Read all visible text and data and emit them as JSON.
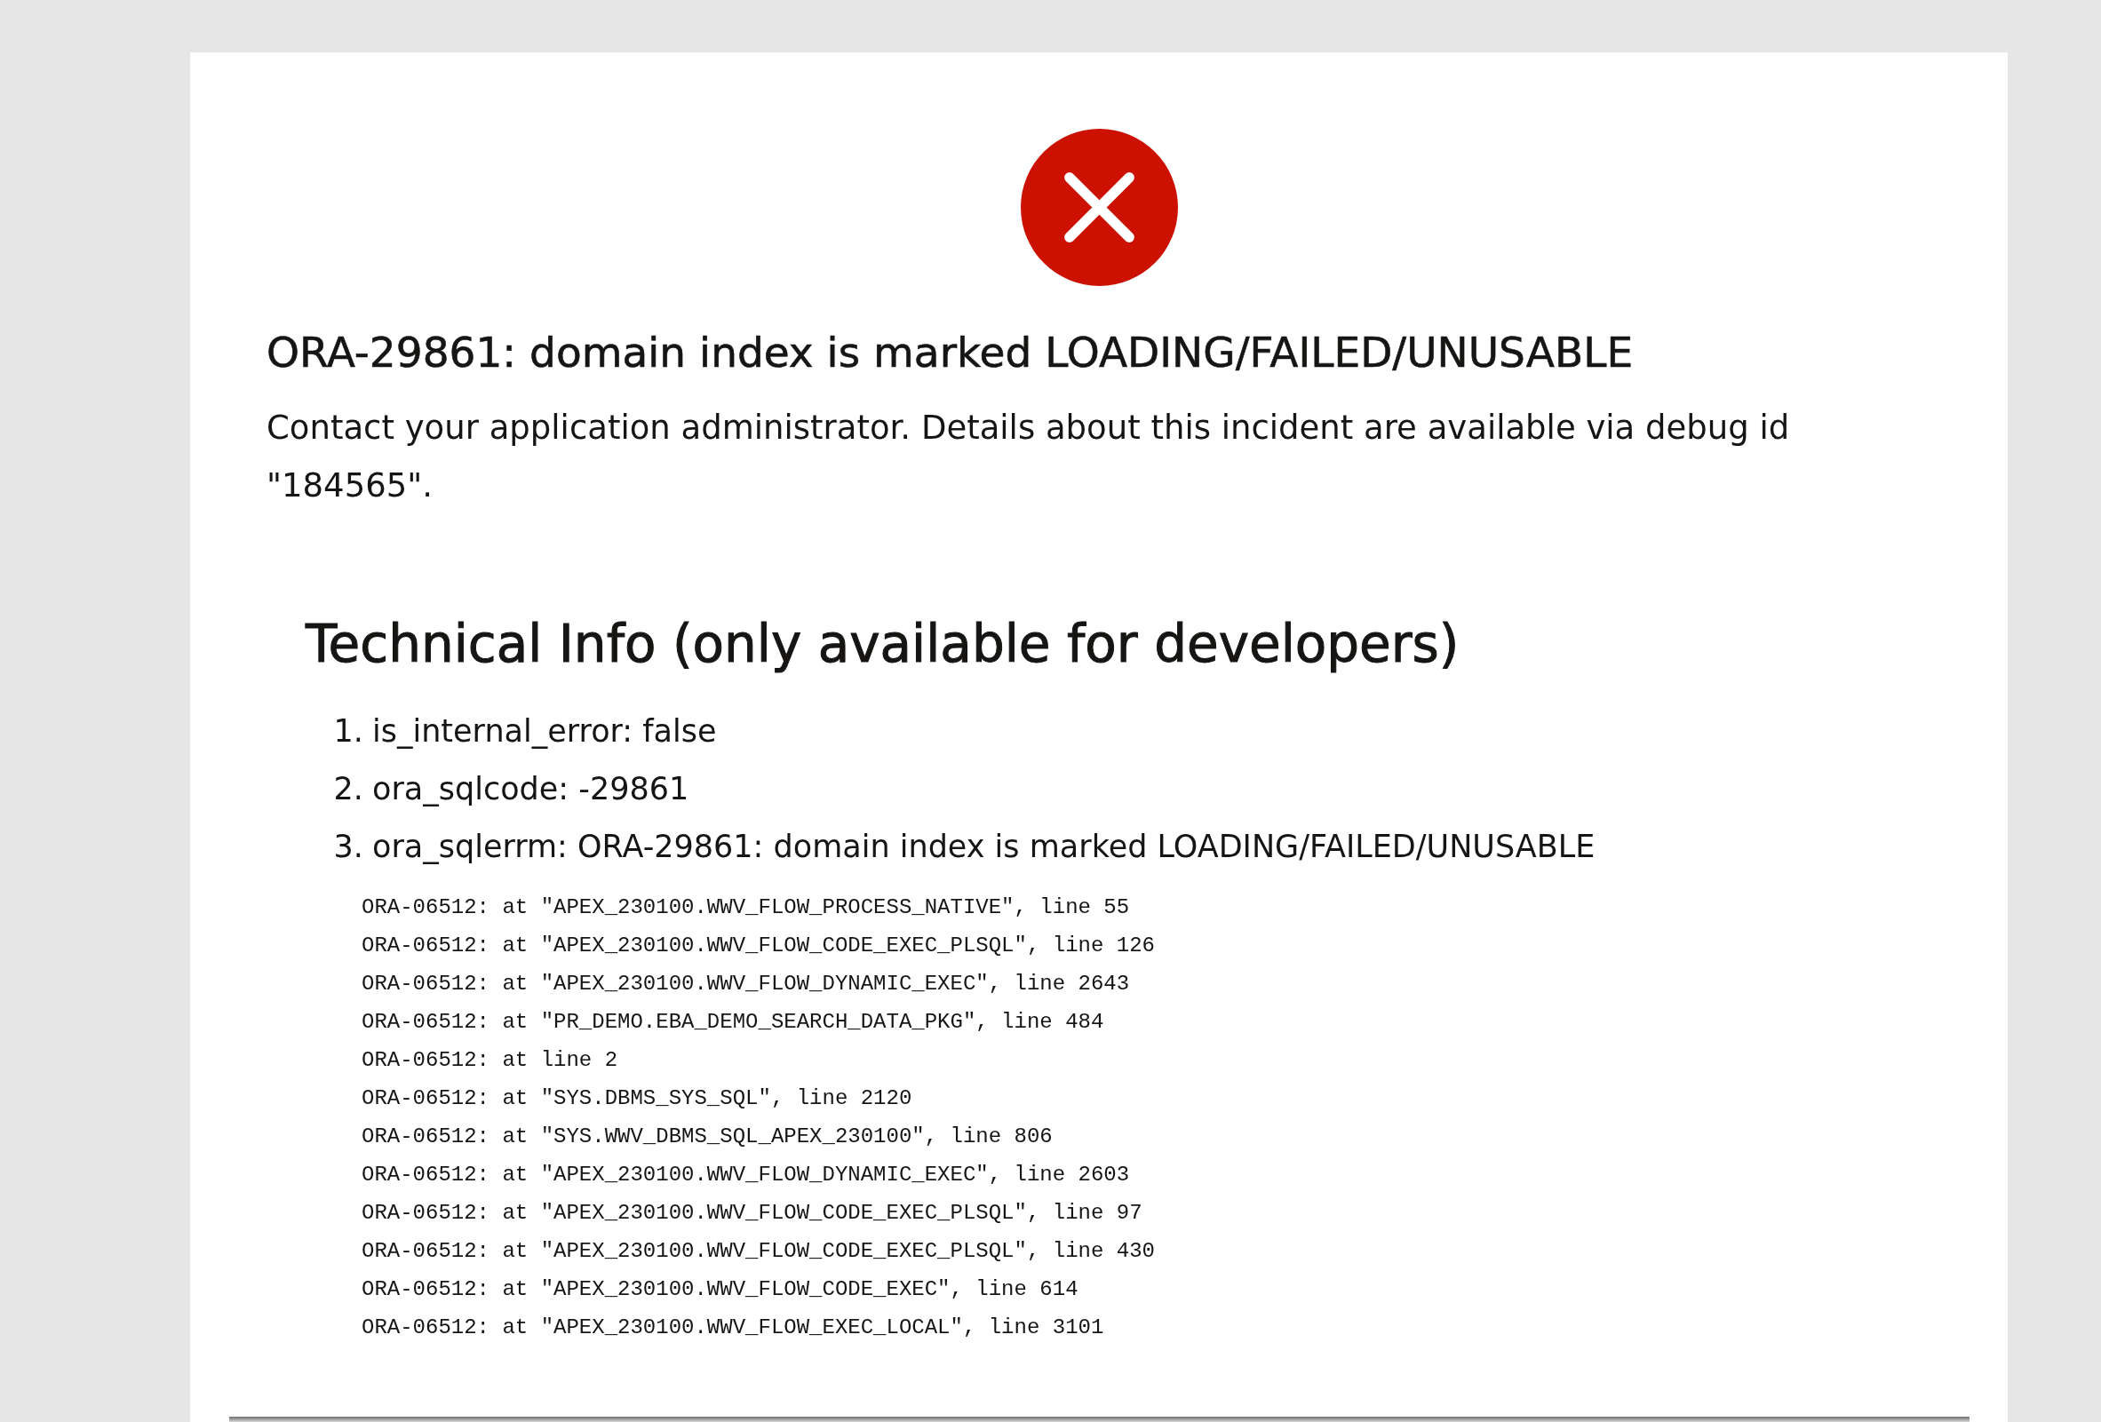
{
  "error": {
    "title": "ORA-29861: domain index is marked LOADING/FAILED/UNUSABLE",
    "message": "Contact your application administrator. Details about this incident are available via debug id \"184565\"."
  },
  "technical_info": {
    "heading": "Technical Info (only available for developers)",
    "items": [
      {
        "number": "1.",
        "text": "is_internal_error: false"
      },
      {
        "number": "2.",
        "text": "ora_sqlcode: -29861"
      },
      {
        "number": "3.",
        "text": "ora_sqlerrm: ORA-29861: domain index is marked LOADING/FAILED/UNUSABLE"
      }
    ],
    "stack_trace": [
      "ORA-06512: at \"APEX_230100.WWV_FLOW_PROCESS_NATIVE\", line 55",
      "ORA-06512: at \"APEX_230100.WWV_FLOW_CODE_EXEC_PLSQL\", line 126",
      "ORA-06512: at \"APEX_230100.WWV_FLOW_DYNAMIC_EXEC\", line 2643",
      "ORA-06512: at \"PR_DEMO.EBA_DEMO_SEARCH_DATA_PKG\", line 484",
      "ORA-06512: at line 2",
      "ORA-06512: at \"SYS.DBMS_SYS_SQL\", line 2120",
      "ORA-06512: at \"SYS.WWV_DBMS_SQL_APEX_230100\", line 806",
      "ORA-06512: at \"APEX_230100.WWV_FLOW_DYNAMIC_EXEC\", line 2603",
      "ORA-06512: at \"APEX_230100.WWV_FLOW_CODE_EXEC_PLSQL\", line 97",
      "ORA-06512: at \"APEX_230100.WWV_FLOW_CODE_EXEC_PLSQL\", line 430",
      "ORA-06512: at \"APEX_230100.WWV_FLOW_CODE_EXEC\", line 614",
      "ORA-06512: at \"APEX_230100.WWV_FLOW_EXEC_LOCAL\", line 3101"
    ]
  }
}
